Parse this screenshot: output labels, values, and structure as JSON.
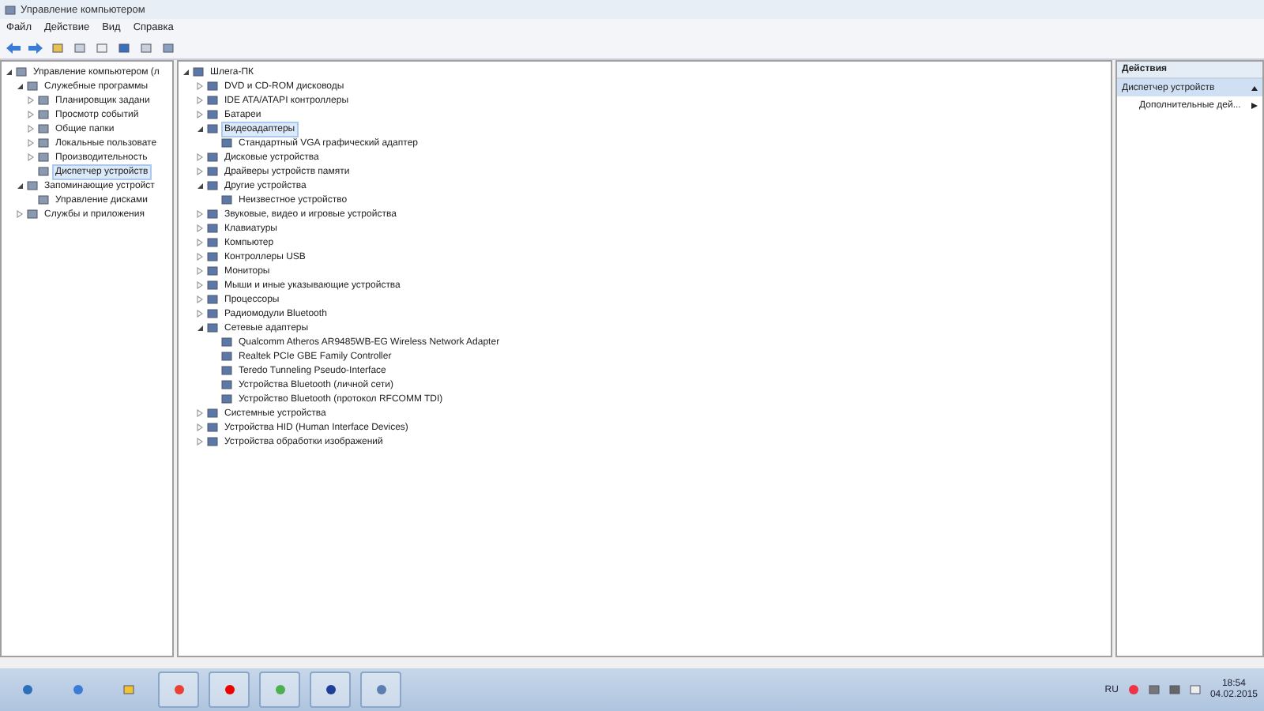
{
  "window": {
    "title": "Управление компьютером"
  },
  "menu": [
    "Файл",
    "Действие",
    "Вид",
    "Справка"
  ],
  "sidebar": {
    "items": [
      {
        "label": "Управление компьютером (л",
        "selected": false,
        "expanded": true,
        "children": [
          {
            "label": "Служебные программы",
            "selected": false,
            "expanded": true,
            "children": [
              {
                "label": "Планировщик задани",
                "selected": false,
                "expanded": false
              },
              {
                "label": "Просмотр событий",
                "selected": false,
                "expanded": false
              },
              {
                "label": "Общие папки",
                "selected": false,
                "expanded": false
              },
              {
                "label": "Локальные пользовате",
                "selected": false,
                "expanded": false
              },
              {
                "label": "Производительность",
                "selected": false,
                "expanded": false
              },
              {
                "label": "Диспетчер устройств",
                "selected": true
              }
            ]
          },
          {
            "label": "Запоминающие устройст",
            "selected": false,
            "expanded": true,
            "children": [
              {
                "label": "Управление дисками",
                "selected": false
              }
            ]
          },
          {
            "label": "Службы и приложения",
            "selected": false,
            "expanded": false
          }
        ]
      }
    ]
  },
  "device_tree": [
    {
      "label": "Шлега-ПК",
      "selected": false,
      "expanded": true,
      "children": [
        {
          "label": "DVD и CD-ROM дисководы",
          "selected": false,
          "expanded": false
        },
        {
          "label": "IDE ATA/ATAPI контроллеры",
          "selected": false,
          "expanded": false
        },
        {
          "label": "Батареи",
          "selected": false,
          "expanded": false
        },
        {
          "label": "Видеоадаптеры",
          "selected": true,
          "expanded": true,
          "children": [
            {
              "label": "Стандартный VGA графический адаптер",
              "selected": false
            }
          ]
        },
        {
          "label": "Дисковые устройства",
          "selected": false,
          "expanded": false
        },
        {
          "label": "Драйверы устройств памяти",
          "selected": false,
          "expanded": false
        },
        {
          "label": "Другие устройства",
          "selected": false,
          "expanded": true,
          "children": [
            {
              "label": "Неизвестное устройство",
              "selected": false
            }
          ]
        },
        {
          "label": "Звуковые, видео и игровые устройства",
          "selected": false,
          "expanded": false
        },
        {
          "label": "Клавиатуры",
          "selected": false,
          "expanded": false
        },
        {
          "label": "Компьютер",
          "selected": false,
          "expanded": false
        },
        {
          "label": "Контроллеры USB",
          "selected": false,
          "expanded": false
        },
        {
          "label": "Мониторы",
          "selected": false,
          "expanded": false
        },
        {
          "label": "Мыши и иные указывающие устройства",
          "selected": false,
          "expanded": false
        },
        {
          "label": "Процессоры",
          "selected": false,
          "expanded": false
        },
        {
          "label": "Радиомодули Bluetooth",
          "selected": false,
          "expanded": false
        },
        {
          "label": "Сетевые адаптеры",
          "selected": false,
          "expanded": true,
          "children": [
            {
              "label": "Qualcomm Atheros AR9485WB-EG Wireless Network Adapter",
              "selected": false
            },
            {
              "label": "Realtek PCIe GBE Family Controller",
              "selected": false
            },
            {
              "label": "Teredo Tunneling Pseudo-Interface",
              "selected": false
            },
            {
              "label": "Устройства Bluetooth (личной сети)",
              "selected": false
            },
            {
              "label": "Устройство Bluetooth (протокол RFCOMM TDI)",
              "selected": false
            }
          ]
        },
        {
          "label": "Системные устройства",
          "selected": false,
          "expanded": false
        },
        {
          "label": "Устройства HID (Human Interface Devices)",
          "selected": false,
          "expanded": false
        },
        {
          "label": "Устройства обработки изображений",
          "selected": false,
          "expanded": false
        }
      ]
    }
  ],
  "actions": {
    "title": "Действия",
    "items": [
      {
        "label": "Диспетчер устройств",
        "kind": "section",
        "selected": true
      },
      {
        "label": "Дополнительные дей...",
        "kind": "submenu",
        "selected": false
      }
    ]
  },
  "taskbar": {
    "language": "RU",
    "time": "18:54",
    "date": "04.02.2015"
  }
}
